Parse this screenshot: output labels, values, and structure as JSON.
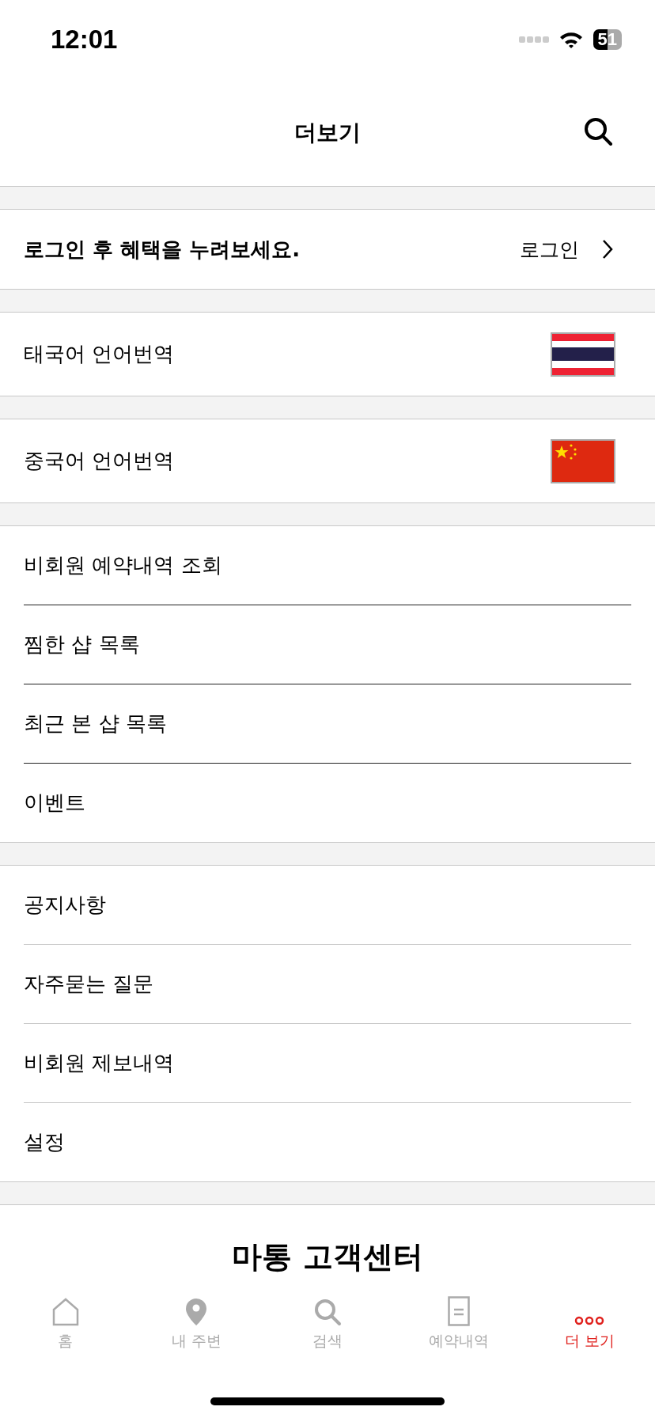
{
  "status_bar": {
    "time": "12:01",
    "battery": "51"
  },
  "header": {
    "title": "더보기"
  },
  "login_banner": {
    "message": "로그인 후 혜택을 누려보세요.",
    "action": "로그인"
  },
  "translations": [
    {
      "label": "태국어 언어번역",
      "kind": "thai"
    },
    {
      "label": "중국어 언어번역",
      "kind": "china"
    }
  ],
  "menu_groups": [
    {
      "items": [
        "비회원 예약내역 조회",
        "찜한 샵 목록",
        "최근 본 샵 목록",
        "이벤트"
      ]
    },
    {
      "items": [
        "공지사항",
        "자주묻는 질문",
        "비회원 제보내역",
        "설정"
      ]
    }
  ],
  "footer": {
    "title": "마통 고객센터"
  },
  "tab_bar": [
    {
      "label": "홈",
      "selected": false
    },
    {
      "label": "내 주변",
      "selected": false
    },
    {
      "label": "검색",
      "selected": false
    },
    {
      "label": "예약내역",
      "selected": false
    },
    {
      "label": "더 보기",
      "selected": true
    }
  ]
}
